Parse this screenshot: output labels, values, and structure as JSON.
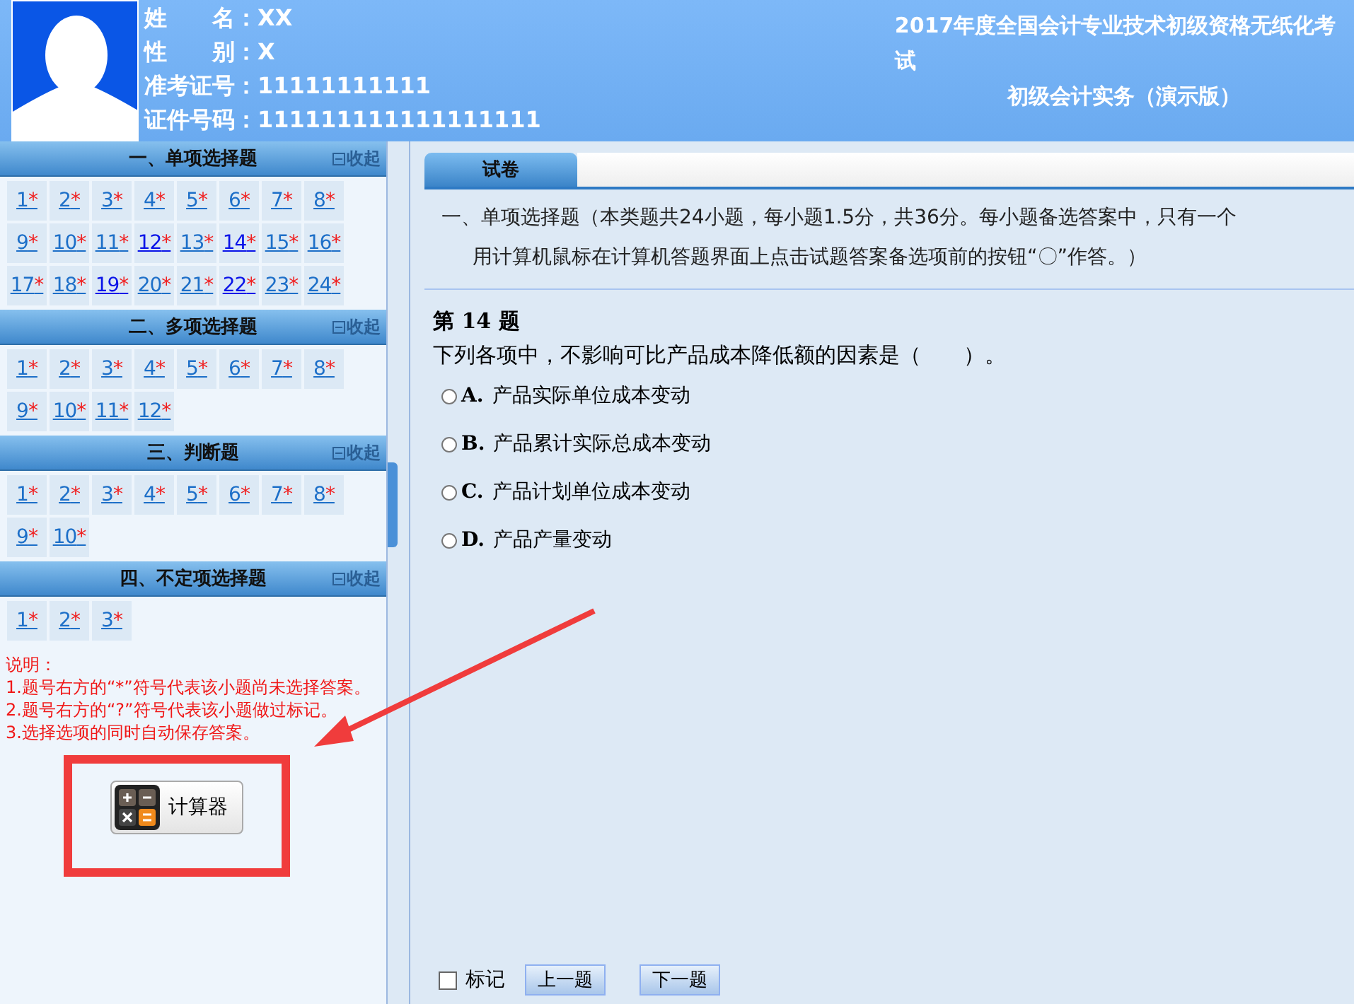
{
  "header": {
    "info": [
      {
        "label": "姓　　名：",
        "value": "XX"
      },
      {
        "label": "性　　别：",
        "value": "X"
      },
      {
        "label": "准考证号：",
        "value": "11111111111"
      },
      {
        "label": "证件号码：",
        "value": "111111111111111111"
      }
    ],
    "title_lines": [
      "2017年度全国会计专业技术初级资格无纸化考试",
      "初级会计实务（演示版）"
    ]
  },
  "sections": [
    {
      "title": "一、单项选择题",
      "toggle": "收起",
      "items": [
        {
          "number": "1",
          "mark": "*",
          "visited": false
        },
        {
          "number": "2",
          "mark": "*",
          "visited": false
        },
        {
          "number": "3",
          "mark": "*",
          "visited": false
        },
        {
          "number": "4",
          "mark": "*",
          "visited": false
        },
        {
          "number": "5",
          "mark": "*",
          "visited": false
        },
        {
          "number": "6",
          "mark": "*",
          "visited": false
        },
        {
          "number": "7",
          "mark": "*",
          "visited": false
        },
        {
          "number": "8",
          "mark": "*",
          "visited": false
        },
        {
          "number": "9",
          "mark": "*",
          "visited": false
        },
        {
          "number": "10",
          "mark": "*",
          "visited": false
        },
        {
          "number": "11",
          "mark": "*",
          "visited": false
        },
        {
          "number": "12",
          "mark": "*",
          "visited": true
        },
        {
          "number": "13",
          "mark": "*",
          "visited": false
        },
        {
          "number": "14",
          "mark": "*",
          "visited": true
        },
        {
          "number": "15",
          "mark": "*",
          "visited": false
        },
        {
          "number": "16",
          "mark": "*",
          "visited": false
        },
        {
          "number": "17",
          "mark": "*",
          "visited": false
        },
        {
          "number": "18",
          "mark": "*",
          "visited": false
        },
        {
          "number": "19",
          "mark": "*",
          "visited": true
        },
        {
          "number": "20",
          "mark": "*",
          "visited": false
        },
        {
          "number": "21",
          "mark": "*",
          "visited": false
        },
        {
          "number": "22",
          "mark": "*",
          "visited": true
        },
        {
          "number": "23",
          "mark": "*",
          "visited": false
        },
        {
          "number": "24",
          "mark": "*",
          "visited": false
        }
      ]
    },
    {
      "title": "二、多项选择题",
      "toggle": "收起",
      "items": [
        {
          "number": "1",
          "mark": "*",
          "visited": false
        },
        {
          "number": "2",
          "mark": "*",
          "visited": false
        },
        {
          "number": "3",
          "mark": "*",
          "visited": false
        },
        {
          "number": "4",
          "mark": "*",
          "visited": false
        },
        {
          "number": "5",
          "mark": "*",
          "visited": false
        },
        {
          "number": "6",
          "mark": "*",
          "visited": false
        },
        {
          "number": "7",
          "mark": "*",
          "visited": false
        },
        {
          "number": "8",
          "mark": "*",
          "visited": false
        },
        {
          "number": "9",
          "mark": "*",
          "visited": false
        },
        {
          "number": "10",
          "mark": "*",
          "visited": false
        },
        {
          "number": "11",
          "mark": "*",
          "visited": false
        },
        {
          "number": "12",
          "mark": "*",
          "visited": false
        }
      ]
    },
    {
      "title": "三、判断题",
      "toggle": "收起",
      "items": [
        {
          "number": "1",
          "mark": "*",
          "visited": false
        },
        {
          "number": "2",
          "mark": "*",
          "visited": false
        },
        {
          "number": "3",
          "mark": "*",
          "visited": false
        },
        {
          "number": "4",
          "mark": "*",
          "visited": false
        },
        {
          "number": "5",
          "mark": "*",
          "visited": false
        },
        {
          "number": "6",
          "mark": "*",
          "visited": false
        },
        {
          "number": "7",
          "mark": "*",
          "visited": false
        },
        {
          "number": "8",
          "mark": "*",
          "visited": false
        },
        {
          "number": "9",
          "mark": "*",
          "visited": false
        },
        {
          "number": "10",
          "mark": "*",
          "visited": false
        }
      ]
    },
    {
      "title": "四、不定项选择题",
      "toggle": "收起",
      "items": [
        {
          "number": "1",
          "mark": "*",
          "visited": false
        },
        {
          "number": "2",
          "mark": "*",
          "visited": false
        },
        {
          "number": "3",
          "mark": "*",
          "visited": false
        }
      ]
    }
  ],
  "notes": {
    "heading": "说明：",
    "lines": [
      "1.题号右方的“*”符号代表该小题尚未选择答案。",
      "2.题号右方的“?”符号代表该小题做过标记。",
      "3.选择选项的同时自动保存答案。"
    ]
  },
  "calculator": {
    "label": "计算器"
  },
  "tabs": [
    {
      "label": "试卷",
      "selected": true
    }
  ],
  "instructions": [
    "一、单项选择题（本类题共24小题，每小题1.5分，共36分。每小题备选答案中，只有一个",
    "用计算机鼠标在计算机答题界面上点击试题答案备选项前的按钮“〇”作答。）"
  ],
  "question": {
    "heading": "第 14 题",
    "stem": "下列各项中，不影响可比产品成本降低额的因素是（　　）。",
    "options": [
      {
        "letter": "A.",
        "text": "产品实际单位成本变动",
        "selected": false
      },
      {
        "letter": "B.",
        "text": "产品累计实际总成本变动",
        "selected": false
      },
      {
        "letter": "C.",
        "text": "产品计划单位成本变动",
        "selected": false
      },
      {
        "letter": "D.",
        "text": "产品产量变动",
        "selected": false
      }
    ]
  },
  "footer": {
    "mark": {
      "label": "标记",
      "checked": false
    },
    "buttons": [
      "上一题",
      "下一题"
    ]
  }
}
